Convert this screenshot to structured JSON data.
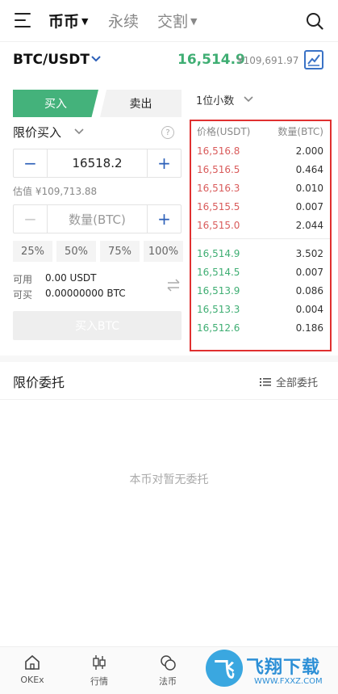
{
  "nav": {
    "tabs": [
      {
        "label": "币币",
        "active": true
      },
      {
        "label": "永续",
        "active": false
      },
      {
        "label": "交割",
        "active": false
      }
    ]
  },
  "pair": {
    "symbol": "BTC/USDT",
    "last_price": "16,514.9",
    "last_price_cny": "¥109,691.97"
  },
  "trade": {
    "buy_label": "买入",
    "sell_label": "卖出",
    "order_type": "限价买入",
    "help": "?",
    "price_value": "16518.2",
    "estimate": "估值 ¥109,713.88",
    "qty_placeholder": "数量(BTC)",
    "minus": "−",
    "plus": "+",
    "percents": [
      "25%",
      "50%",
      "75%",
      "100%"
    ],
    "available_label": "可用",
    "available_value": "0.00 USDT",
    "buyable_label": "可买",
    "buyable_value": "0.00000000 BTC",
    "submit_label": "买入BTC"
  },
  "book": {
    "decimals": "1位小数",
    "price_header": "价格(USDT)",
    "qty_header": "数量(BTC)",
    "asks": [
      {
        "price": "16,516.8",
        "qty": "2.000"
      },
      {
        "price": "16,516.5",
        "qty": "0.464"
      },
      {
        "price": "16,516.3",
        "qty": "0.010"
      },
      {
        "price": "16,515.5",
        "qty": "0.007"
      },
      {
        "price": "16,515.0",
        "qty": "2.044"
      }
    ],
    "bids": [
      {
        "price": "16,514.9",
        "qty": "3.502"
      },
      {
        "price": "16,514.5",
        "qty": "0.007"
      },
      {
        "price": "16,513.9",
        "qty": "0.086"
      },
      {
        "price": "16,513.3",
        "qty": "0.004"
      },
      {
        "price": "16,512.6",
        "qty": "0.186"
      }
    ]
  },
  "orders": {
    "title": "限价委托",
    "all_label": "全部委托",
    "empty_text": "本币对暂无委托"
  },
  "bottom_nav": [
    {
      "label": "OKEx",
      "icon": "home-icon"
    },
    {
      "label": "行情",
      "icon": "candlestick-icon"
    },
    {
      "label": "法币",
      "icon": "coins-icon"
    }
  ],
  "watermark": {
    "logo": "飞",
    "text": "飞翔下载",
    "url": "WWW.FXXZ.COM"
  },
  "colors": {
    "up": "#3fae73",
    "down": "#d95b5b",
    "accent": "#2b5fb8",
    "buy": "#44b27b"
  }
}
